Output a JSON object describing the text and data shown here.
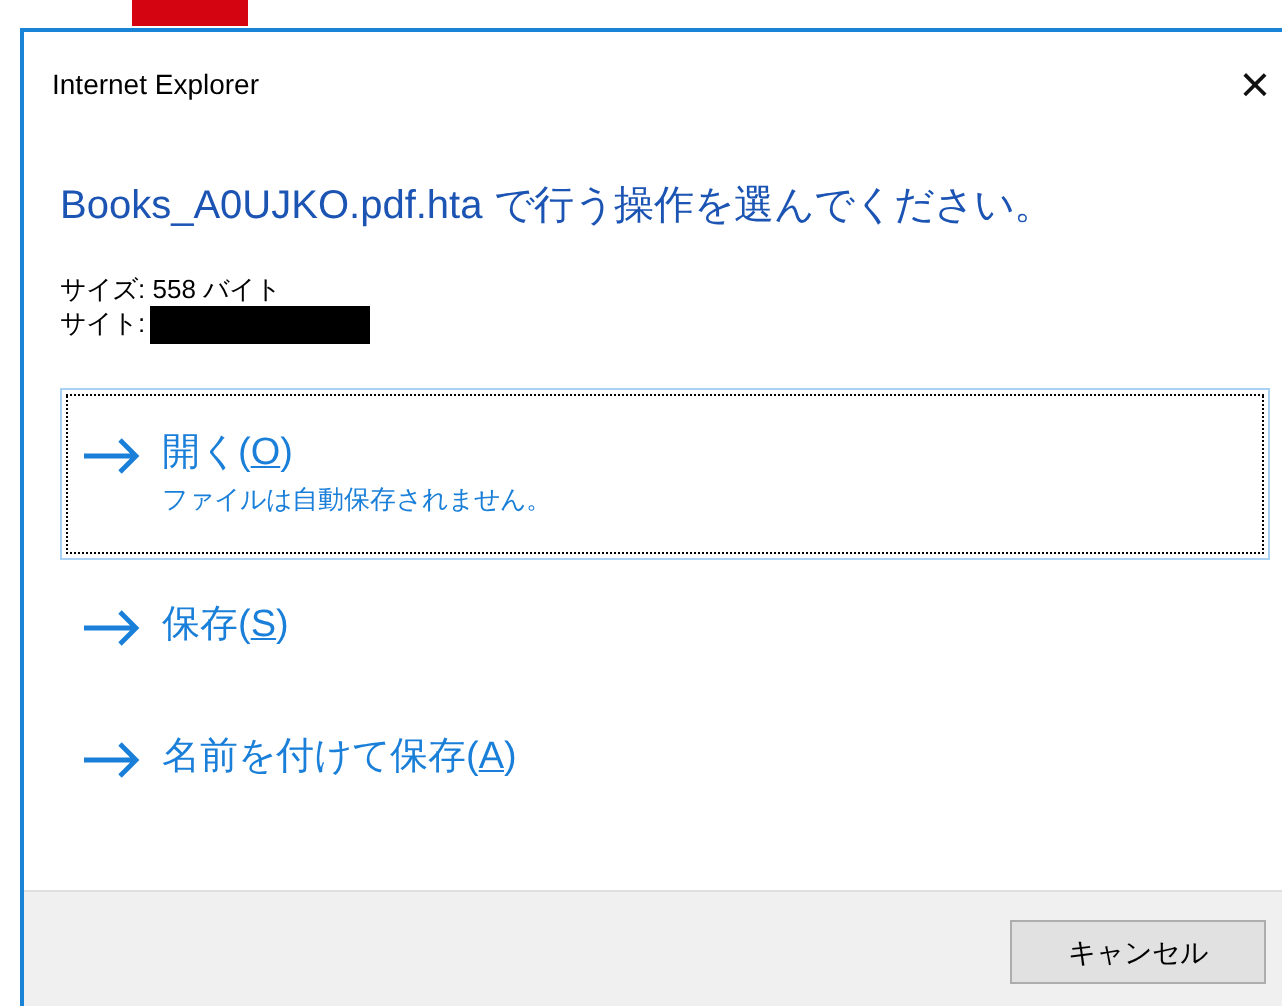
{
  "window": {
    "title": "Internet Explorer",
    "close": "×"
  },
  "heading": "Books_A0UJKO.pdf.hta で行う操作を選んでください。",
  "details": [
    {
      "label": "サイズ:",
      "value": "558 バイト",
      "redacted": false
    },
    {
      "label": "サイト:",
      "redacted": true
    }
  ],
  "options": [
    {
      "label_before": "開く(",
      "access_key": "O",
      "label_after": ")",
      "note": "ファイルは自動保存されません。",
      "selected": true
    },
    {
      "label_before": "保存(",
      "access_key": "S",
      "label_after": ")",
      "selected": false
    },
    {
      "label_before": "名前を付けて保存(",
      "access_key": "A",
      "label_after": ")",
      "selected": false
    }
  ],
  "buttons": [
    "キャンセル"
  ]
}
